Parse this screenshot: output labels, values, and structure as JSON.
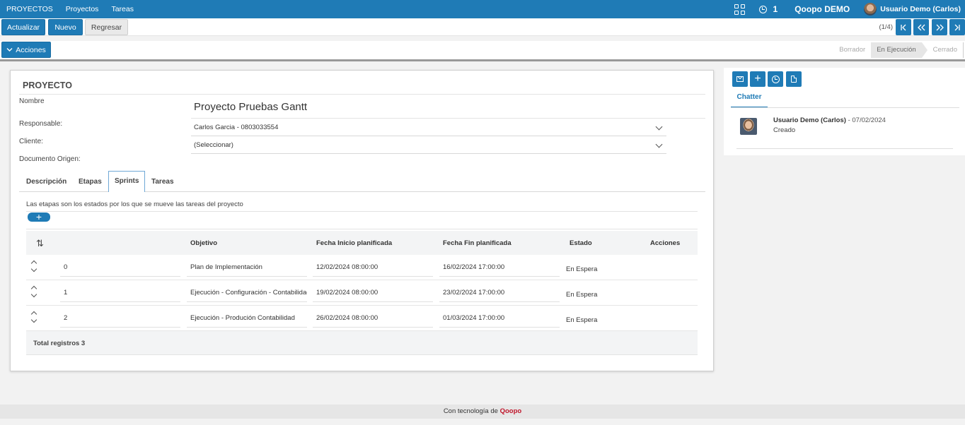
{
  "topbar": {
    "brand": "PROYECTOS",
    "menu": [
      "Proyectos",
      "Tareas"
    ],
    "activity_count": "1",
    "company": "Qoopo DEMO",
    "user": "Usuario Demo (Carlos)"
  },
  "toolbar": {
    "refresh_label": "Actualizar",
    "new_label": "Nuevo",
    "back_label": "Regresar",
    "pager": "(1/4)",
    "actions_label": "Acciones"
  },
  "stages": [
    "Borrador",
    "En Ejecución",
    "Cerrado"
  ],
  "active_stage": "En Ejecución",
  "form": {
    "title": "PROYECTO",
    "name_label": "Nombre",
    "name_value": "Proyecto Pruebas Gantt",
    "responsible_label": "Responsable:",
    "responsible_value": "Carlos Garcia - 0803033554",
    "client_label": "Cliente:",
    "client_value": "(Seleccionar)",
    "origin_label": "Documento Origen:"
  },
  "tabs": [
    "Descripción",
    "Etapas",
    "Sprints",
    "Tareas"
  ],
  "active_tab": "Sprints",
  "sprints": {
    "description": "Las etapas son los estados por los que se mueve las tareas del proyecto",
    "columns": [
      "Objetivo",
      "Fecha Inicio planificada",
      "Fecha Fin planificada",
      "Estado",
      "Acciones"
    ],
    "rows": [
      {
        "seq": "0",
        "objetivo": "Plan de Implementación",
        "inicio": "12/02/2024 08:00:00",
        "fin": "16/02/2024 17:00:00",
        "estado": "En Espera"
      },
      {
        "seq": "1",
        "objetivo": "Ejecución - Configuración - Contabilidad",
        "inicio": "19/02/2024 08:00:00",
        "fin": "23/02/2024 17:00:00",
        "estado": "En Espera"
      },
      {
        "seq": "2",
        "objetivo": "Ejecución - Produción Contabilidad",
        "inicio": "26/02/2024 08:00:00",
        "fin": "01/03/2024 17:00:00",
        "estado": "En Espera"
      }
    ],
    "total": "Total registros 3"
  },
  "chatter": {
    "tab": "Chatter",
    "message": {
      "author": "Usuario Demo (Carlos)",
      "date": " - 07/02/2024",
      "body": "Creado"
    }
  },
  "footer": {
    "text": "Con tecnología de ",
    "brand": "Qoopo"
  },
  "colors": {
    "primary": "#1f7bb6",
    "footer_brand": "#c0152a"
  }
}
